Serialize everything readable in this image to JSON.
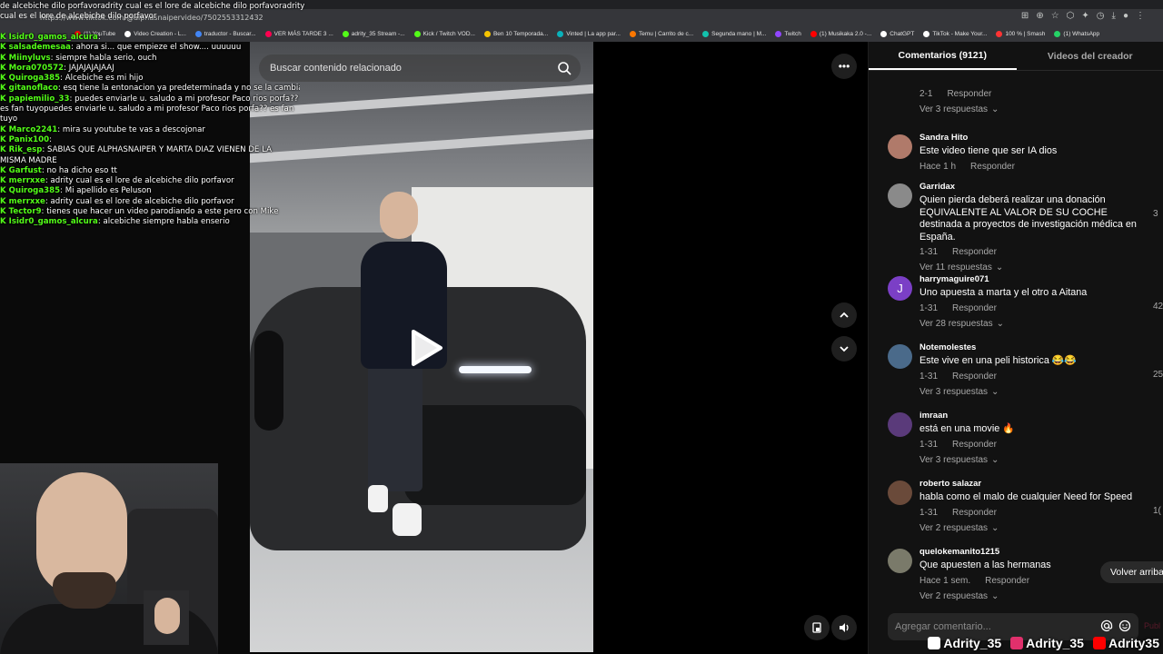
{
  "browser": {
    "url": "https://www.tiktok.com/@alphasnaipervideo/7502553312432"
  },
  "bookmarks": [
    {
      "label": "(1) YouTube",
      "color": "#ff0000"
    },
    {
      "label": "Video Creation - L...",
      "color": "#ffffff"
    },
    {
      "label": "traductor - Buscar...",
      "color": "#4285f4"
    },
    {
      "label": "VER MÁS TARDE 3 ...",
      "color": "#ff0050"
    },
    {
      "label": "adrity_35 Stream -...",
      "color": "#53fc18"
    },
    {
      "label": "Kick / Twitch VOD...",
      "color": "#53fc18"
    },
    {
      "label": "Ben 10 Temporada...",
      "color": "#f5c400"
    },
    {
      "label": "Vinted | La app par...",
      "color": "#09b1ba"
    },
    {
      "label": "Temu | Carrito de c...",
      "color": "#fb7701"
    },
    {
      "label": "Segunda mano | M...",
      "color": "#13c1ac"
    },
    {
      "label": "Twitch",
      "color": "#9146ff"
    },
    {
      "label": "(1) Musikaka 2.0 -...",
      "color": "#ff0000"
    },
    {
      "label": "ChatGPT",
      "color": "#ffffff"
    },
    {
      "label": "TikTok - Make Your...",
      "color": "#ffffff"
    },
    {
      "label": "100 % | Smash",
      "color": "#ff3333"
    },
    {
      "label": "(1) WhatsApp",
      "color": "#25d366"
    }
  ],
  "ticker": "de alcebiche dilo porfavoradrity cual es el lore de alcebiche dilo porfavoradrity cual es el lore de alcebiche dilo porfavor",
  "chat": [
    {
      "user": "Isidr0_gamos_alcura",
      "msg": ""
    },
    {
      "user": "salsademesaa",
      "msg": "ahora si... que empieze el show.... uuuuuu"
    },
    {
      "user": "Miinyluvs",
      "msg": "siempre habla serio, ouch"
    },
    {
      "user": "Mora070572",
      "msg": "JAJAJAJAJAAJ"
    },
    {
      "user": "Quiroga385",
      "msg": "Alcebiche es mi hijo"
    },
    {
      "user": "gitanoflaco",
      "msg": "esq tiene la entonacion ya predeterminada y no se la cambia"
    },
    {
      "user": "papiemilio_33",
      "msg": "puedes enviarle u. saludo a mi profesor Paco rios porfa?? es fan tuyopuedes enviarle u. saludo a mi profesor Paco rios porfa?? es fan tuyo"
    },
    {
      "user": "Marco2241",
      "msg": "mira su youtube te vas a descojonar"
    },
    {
      "user": "Panix100",
      "msg": ""
    },
    {
      "user": "Rik_esp",
      "msg": "SABÍAS QUE ALPHASNAIPER Y MARTA DIAZ VIENEN DE LA MISMA MADRE"
    },
    {
      "user": "Garfust",
      "msg": "no ha dicho eso tt"
    },
    {
      "user": "merrxxe",
      "msg": "adrity cual es el lore de alcebiche dilo porfavor"
    },
    {
      "user": "Quiroga385",
      "msg": "Mi apellido es Peluson"
    },
    {
      "user": "merrxxe",
      "msg": "adrity cual es el lore de alcebiche dilo porfavor"
    },
    {
      "user": "Tector9",
      "msg": "tienes que hacer un video parodiando a este pero con Mike"
    },
    {
      "user": "Isidr0_gamos_alcura",
      "msg": "alcebiche siempre habla enserio"
    }
  ],
  "video": {
    "search_placeholder": "Buscar contenido relacionado"
  },
  "comments_panel": {
    "tab_comments": "Comentarios (9121)",
    "tab_videos": "Videos del creador",
    "reply_label": "Responder",
    "top_item": {
      "date": "2-1",
      "replies": "Ver 3 respuestas"
    },
    "comments": [
      {
        "name": "Sandra Hito",
        "text": "Este video tiene que ser IA dios",
        "date": "Hace 1 h",
        "likes": "",
        "replies": "",
        "avatar": "#b07a6a"
      },
      {
        "name": "Garridax",
        "text": "Quien pierda deberá realizar una donación EQUIVALENTE AL VALOR DE SU COCHE destinada a proyectos de investigación médica en España.",
        "date": "1-31",
        "likes": "3",
        "replies": "Ver 11 respuestas",
        "avatar": "#8a8a8a"
      },
      {
        "name": "harrymaguire071",
        "text": "Uno apuesta a marta y el otro a Aitana",
        "date": "1-31",
        "likes": "42",
        "replies": "Ver 28 respuestas",
        "avatar": "#7b3fc6",
        "initial": "J"
      },
      {
        "name": "Notemolestes",
        "text": "Este vive en una peli historica 😂😂",
        "date": "1-31",
        "likes": "25",
        "replies": "Ver 3 respuestas",
        "avatar": "#4a6a8a"
      },
      {
        "name": "imraan",
        "text": "está en una movie 🔥",
        "date": "1-31",
        "likes": "",
        "replies": "Ver 3 respuestas",
        "avatar": "#5a3a7a"
      },
      {
        "name": "roberto salazar",
        "text": "habla como el malo de cualquier Need for Speed",
        "date": "1-31",
        "likes": "1(",
        "replies": "Ver 2 respuestas",
        "avatar": "#6a4a3a"
      },
      {
        "name": "quelokemanito1215",
        "text": "Que apuesten a las hermanas",
        "date": "Hace 1 sem.",
        "likes": "",
        "replies": "Ver 2 respuestas",
        "avatar": "#7a7a6a"
      }
    ],
    "back_to_top": "Volver arriba",
    "add_comment_placeholder": "Agregar comentario...",
    "post_label": "Publ"
  },
  "socials": [
    {
      "handle": "Adrity_35",
      "network": "tiktok-icon",
      "color": "#ffffff"
    },
    {
      "handle": "Adrity_35",
      "network": "instagram-icon",
      "color": "#e1306c"
    },
    {
      "handle": "Adrity35",
      "network": "youtube-icon",
      "color": "#ff0000"
    }
  ]
}
